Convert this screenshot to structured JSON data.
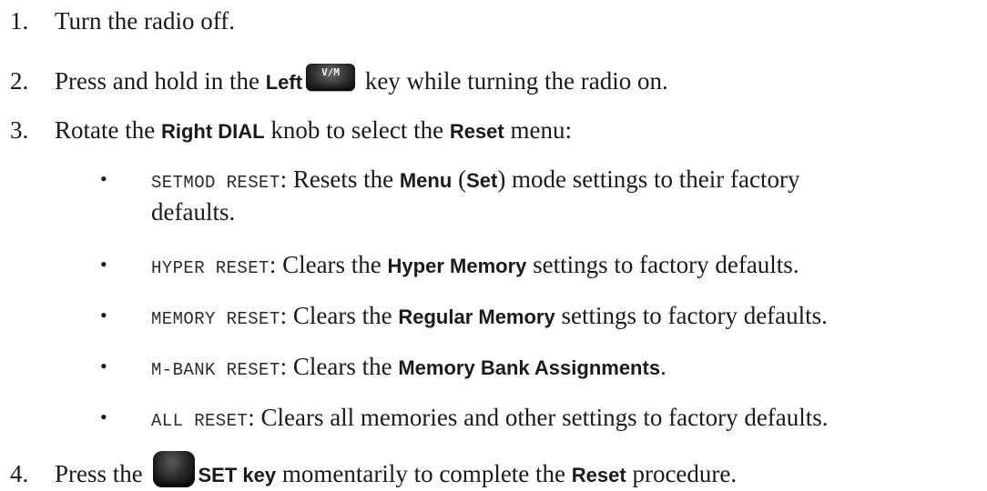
{
  "steps": [
    {
      "number": "1.",
      "text": "Turn the radio off."
    },
    {
      "number": "2.",
      "pre": "Press and hold in the ",
      "key_name": "Left",
      "key_icon_label": "V/M",
      "post": " key while turning the radio on."
    },
    {
      "number": "3.",
      "pre": "Rotate the ",
      "knob": "Right DIAL",
      "mid": " knob to select the ",
      "menu": "Reset",
      "post": " menu:",
      "options": [
        {
          "code": "SETMOD RESET",
          "pre": ": Resets the ",
          "bold1": "Menu",
          "mid1": " (",
          "bold2": "Set",
          "post": ") mode settings to their factory",
          "cont": "defaults."
        },
        {
          "code": "HYPER RESET",
          "pre": ": Clears the ",
          "bold": "Hyper Memory",
          "post": " settings to factory defaults."
        },
        {
          "code": "MEMORY RESET",
          "pre": ": Clears the ",
          "bold": "Regular Memory",
          "post": " settings to factory defaults."
        },
        {
          "code": "M-BANK RESET",
          "pre": ": Clears the ",
          "bold": "Memory Bank Assignments",
          "post": "."
        },
        {
          "code": "ALL RESET",
          "text": ": Clears all memories and other settings to factory defaults."
        }
      ]
    },
    {
      "number": "4.",
      "pre": "Press the ",
      "key_name": "SET key",
      "mid": " momentarily to complete the ",
      "bold": "Reset",
      "post": " procedure."
    }
  ],
  "bullet_char": "•",
  "colors": {
    "text": "#1a1a1a",
    "key_face": "#2c2c2c"
  }
}
